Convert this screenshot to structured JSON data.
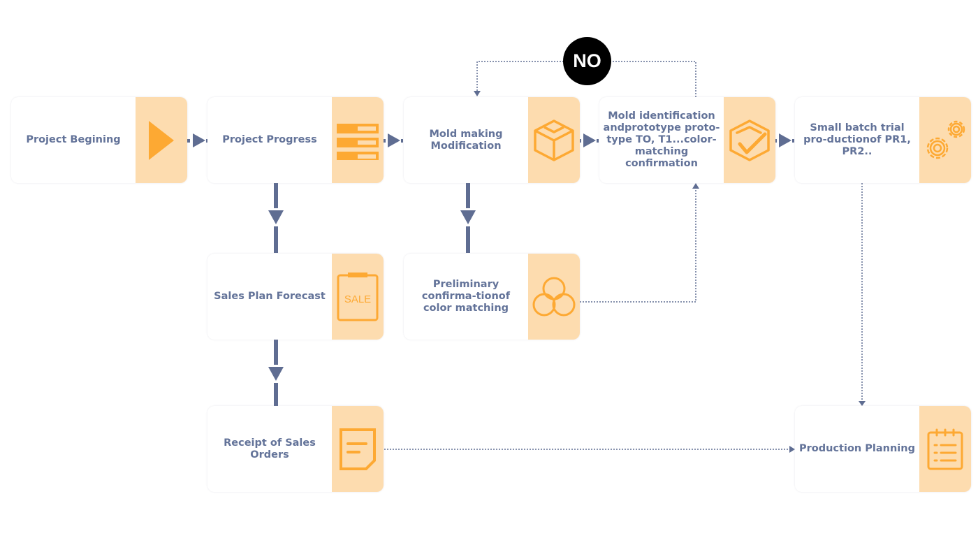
{
  "colors": {
    "text": "#637399",
    "panel": "#fddcaf",
    "icon": "#fda933",
    "connector": "#5f6d92",
    "decision": "#000000"
  },
  "decision": {
    "label": "NO"
  },
  "nodes": [
    {
      "id": "start",
      "label": "Project Begining",
      "icon": "play-icon"
    },
    {
      "id": "progress",
      "label": "Project Progress",
      "icon": "list-bars-icon"
    },
    {
      "id": "mold",
      "label": "Mold making Modification",
      "icon": "box-icon"
    },
    {
      "id": "identify",
      "label": "Mold identification andprototype proto-type TO, T1...color-matching confirmation",
      "icon": "box-check-icon"
    },
    {
      "id": "trial",
      "label": "Small batch trial pro-ductionof PR1, PR2..",
      "icon": "gears-icon"
    },
    {
      "id": "forecast",
      "label": "Sales Plan Forecast",
      "icon": "sale-clipboard-icon",
      "icon_text": "SALE"
    },
    {
      "id": "color",
      "label": "Preliminary confirma-tionof color matching",
      "icon": "color-circles-icon"
    },
    {
      "id": "orders",
      "label": "Receipt of Sales Orders",
      "icon": "document-icon"
    },
    {
      "id": "planning",
      "label": "Production Planning",
      "icon": "checklist-icon"
    }
  ]
}
